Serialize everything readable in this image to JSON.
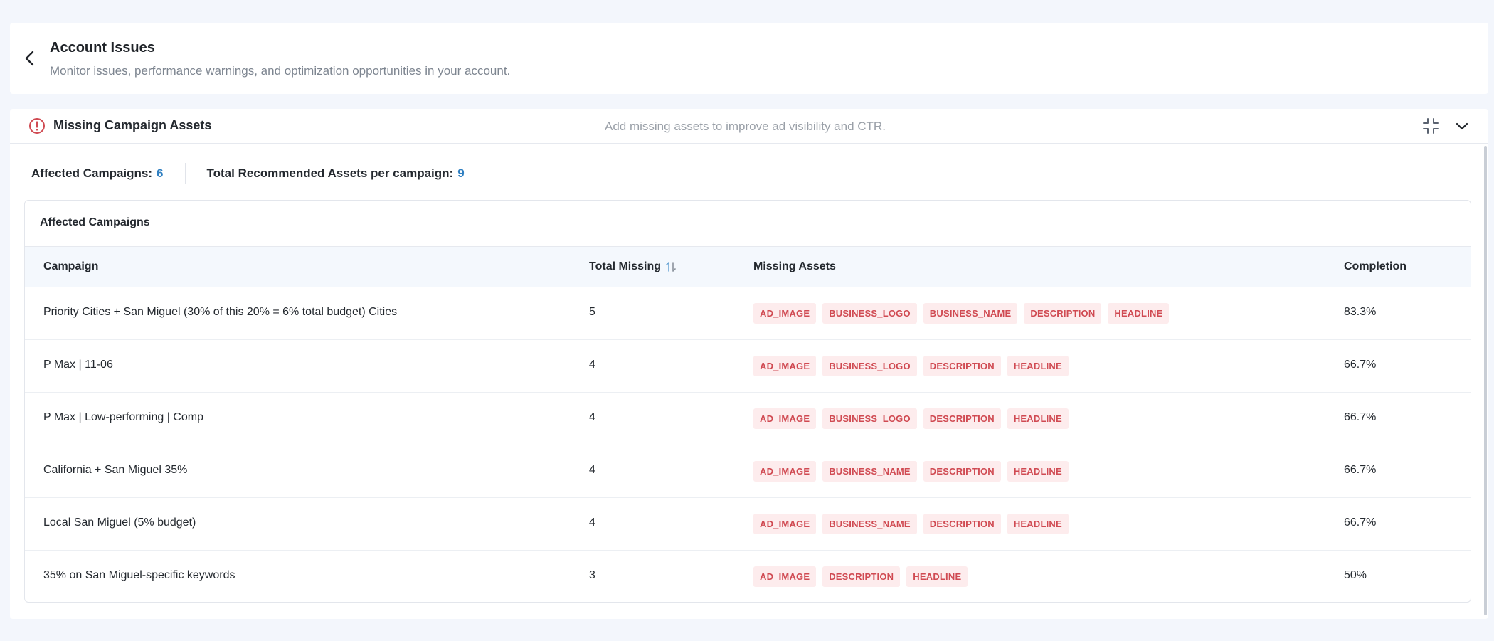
{
  "header": {
    "title": "Account Issues",
    "subtitle": "Monitor issues, performance warnings, and optimization opportunities in your account."
  },
  "panel": {
    "title": "Missing Campaign Assets",
    "hint": "Add missing assets to improve ad visibility and CTR."
  },
  "summary": {
    "affected_label": "Affected Campaigns:",
    "affected_value": "6",
    "recommended_label": "Total Recommended Assets per campaign:",
    "recommended_value": "9"
  },
  "table": {
    "title": "Affected Campaigns",
    "columns": [
      "Campaign",
      "Total Missing",
      "Missing Assets",
      "Completion"
    ],
    "rows": [
      {
        "campaign": "Priority Cities + San Miguel (30% of this 20% = 6% total budget) Cities",
        "total_missing": "5",
        "assets": [
          "AD_IMAGE",
          "BUSINESS_LOGO",
          "BUSINESS_NAME",
          "DESCRIPTION",
          "HEADLINE"
        ],
        "completion": "83.3%"
      },
      {
        "campaign": "P Max | 11-06",
        "total_missing": "4",
        "assets": [
          "AD_IMAGE",
          "BUSINESS_LOGO",
          "DESCRIPTION",
          "HEADLINE"
        ],
        "completion": "66.7%"
      },
      {
        "campaign": "P Max | Low-performing | Comp",
        "total_missing": "4",
        "assets": [
          "AD_IMAGE",
          "BUSINESS_LOGO",
          "DESCRIPTION",
          "HEADLINE"
        ],
        "completion": "66.7%"
      },
      {
        "campaign": "California + San Miguel 35%",
        "total_missing": "4",
        "assets": [
          "AD_IMAGE",
          "BUSINESS_NAME",
          "DESCRIPTION",
          "HEADLINE"
        ],
        "completion": "66.7%"
      },
      {
        "campaign": "Local San Miguel (5% budget)",
        "total_missing": "4",
        "assets": [
          "AD_IMAGE",
          "BUSINESS_NAME",
          "DESCRIPTION",
          "HEADLINE"
        ],
        "completion": "66.7%"
      },
      {
        "campaign": "35% on San Miguel-specific keywords",
        "total_missing": "3",
        "assets": [
          "AD_IMAGE",
          "DESCRIPTION",
          "HEADLINE"
        ],
        "completion": "50%"
      }
    ]
  },
  "icons": {
    "back": "chevron-left-icon",
    "alert": "alert-circle-icon",
    "collapse": "collapse-arrows-icon",
    "expand": "chevron-down-icon",
    "sort": "sort-arrows-icon"
  },
  "colors": {
    "accent": "#2f7fc1",
    "alert": "#d04a52",
    "tag_bg": "#fdeced",
    "table_header_bg": "#f4f8fd"
  }
}
